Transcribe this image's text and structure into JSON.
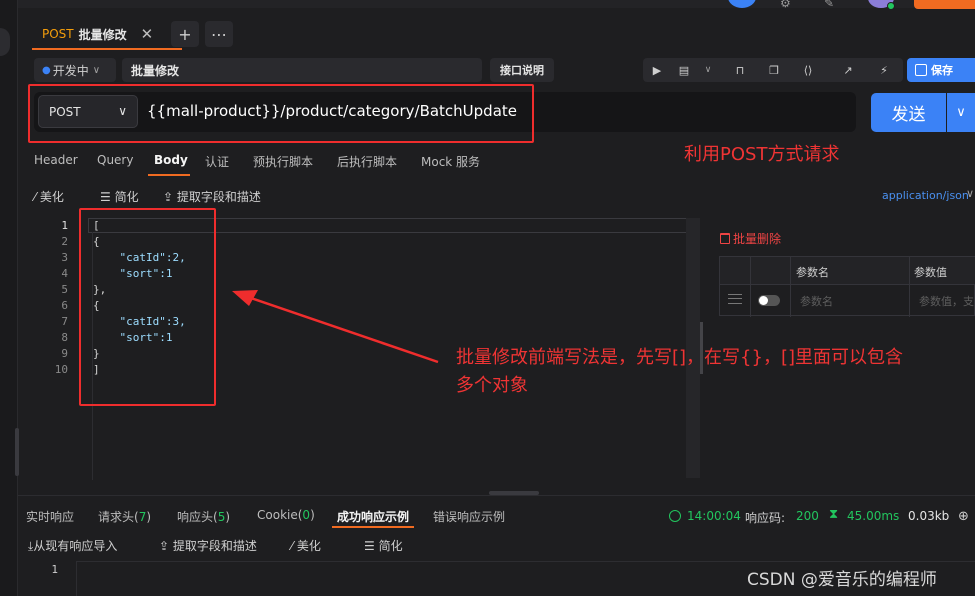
{
  "tab": {
    "method": "POST",
    "name": "批量修改"
  },
  "request": {
    "env": "开发中",
    "name": "批量修改",
    "doc_button": "接口说明",
    "save_label": "保存",
    "method": "POST",
    "url": "{{mall-product}}/product/category/BatchUpdate",
    "send_label": "发送"
  },
  "sub_tabs": [
    "Header",
    "Query",
    "Body",
    "认证",
    "预执行脚本",
    "后执行脚本",
    "Mock 服务"
  ],
  "body_tools": {
    "beautify": "美化",
    "simplify": "简化",
    "extract": "提取字段和描述",
    "content_type": "application/json"
  },
  "editor": {
    "line_numbers": [
      "1",
      "2",
      "3",
      "4",
      "5",
      "6",
      "7",
      "8",
      "9",
      "10"
    ],
    "lines": [
      "[",
      "{",
      "    \"catId\":2,",
      "    \"sort\":1",
      "},",
      "{",
      "    \"catId\":3,",
      "    \"sort\":1",
      "}",
      "]"
    ]
  },
  "params": {
    "bulk_delete": "批量删除",
    "col_name": "参数名",
    "col_value": "参数值",
    "ph_name": "参数名",
    "ph_value": "参数值，支"
  },
  "annotations": {
    "post_note": "利用POST方式请求",
    "body_note_line1": "批量修改前端写法是，先写[]，在写{}，[]里面可以包含",
    "body_note_line2": "多个对象"
  },
  "response_tabs": {
    "realtime": "实时响应",
    "req_headers": "请求头",
    "req_headers_count": "7",
    "resp_headers": "响应头",
    "resp_headers_count": "5",
    "cookie": "Cookie",
    "cookie_count": "0",
    "success_example": "成功响应示例",
    "error_example": "错误响应示例"
  },
  "response_stats": {
    "time": "14:00:04",
    "code_label": "响应码:",
    "code": "200",
    "duration": "45.00ms",
    "size": "0.03kb"
  },
  "response_tools": {
    "import": "从现有响应导入",
    "extract": "提取字段和描述",
    "beautify": "美化",
    "simplify": "简化"
  },
  "response_line": "1",
  "watermark": "CSDN @爱音乐的编程师"
}
